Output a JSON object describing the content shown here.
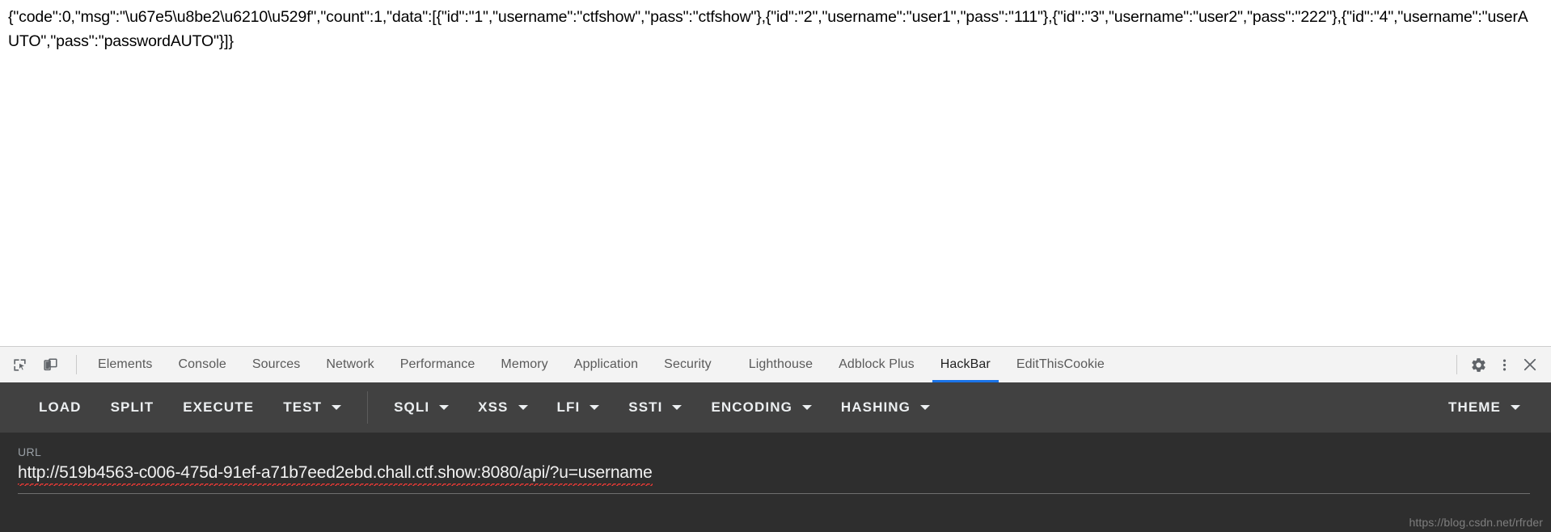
{
  "page": {
    "response_body": "{\"code\":0,\"msg\":\"\\u67e5\\u8be2\\u6210\\u529f\",\"count\":1,\"data\":[{\"id\":\"1\",\"username\":\"ctfshow\",\"pass\":\"ctfshow\"},{\"id\":\"2\",\"username\":\"user1\",\"pass\":\"111\"},{\"id\":\"3\",\"username\":\"user2\",\"pass\":\"222\"},{\"id\":\"4\",\"username\":\"userAUTO\",\"pass\":\"passwordAUTO\"}]}"
  },
  "devtools": {
    "left_icons": [
      {
        "name": "inspect-element-icon",
        "title": "Inspect element"
      },
      {
        "name": "device-toolbar-icon",
        "title": "Toggle device toolbar"
      }
    ],
    "tabs": [
      {
        "label": "Elements",
        "active": false
      },
      {
        "label": "Console",
        "active": false
      },
      {
        "label": "Sources",
        "active": false
      },
      {
        "label": "Network",
        "active": false
      },
      {
        "label": "Performance",
        "active": false
      },
      {
        "label": "Memory",
        "active": false
      },
      {
        "label": "Application",
        "active": false
      },
      {
        "label": "Security",
        "active": false
      },
      {
        "label": "Lighthouse",
        "active": false
      },
      {
        "label": "Adblock Plus",
        "active": false
      },
      {
        "label": "HackBar",
        "active": true
      },
      {
        "label": "EditThisCookie",
        "active": false
      }
    ],
    "right_icons": [
      {
        "name": "settings-gear-icon",
        "title": "Settings"
      },
      {
        "name": "more-options-icon",
        "title": "Customize and control DevTools"
      },
      {
        "name": "close-devtools-icon",
        "title": "Close"
      }
    ],
    "active_tab_accent": "#1a73e8",
    "tabbar_background": "#f3f3f3"
  },
  "hackbar": {
    "toolbar_background": "#414141",
    "panel_background": "#2e2e2e",
    "buttons": [
      {
        "label": "LOAD",
        "has_dropdown": false
      },
      {
        "label": "SPLIT",
        "has_dropdown": false
      },
      {
        "label": "EXECUTE",
        "has_dropdown": false
      },
      {
        "label": "TEST",
        "has_dropdown": true
      },
      {
        "label": "SQLI",
        "has_dropdown": true
      },
      {
        "label": "XSS",
        "has_dropdown": true
      },
      {
        "label": "LFI",
        "has_dropdown": true
      },
      {
        "label": "SSTI",
        "has_dropdown": true
      },
      {
        "label": "ENCODING",
        "has_dropdown": true
      },
      {
        "label": "HASHING",
        "has_dropdown": true
      }
    ],
    "theme_button": {
      "label": "THEME",
      "has_dropdown": true
    },
    "url": {
      "label": "URL",
      "value": "http://519b4563-c006-475d-91ef-a71b7eed2ebd.chall.ctf.show:8080/api/?u=username",
      "placeholder": "http://",
      "spellcheck_underline_color": "#f01b1b"
    }
  },
  "watermark": {
    "text": "https://blog.csdn.net/rfrder"
  }
}
